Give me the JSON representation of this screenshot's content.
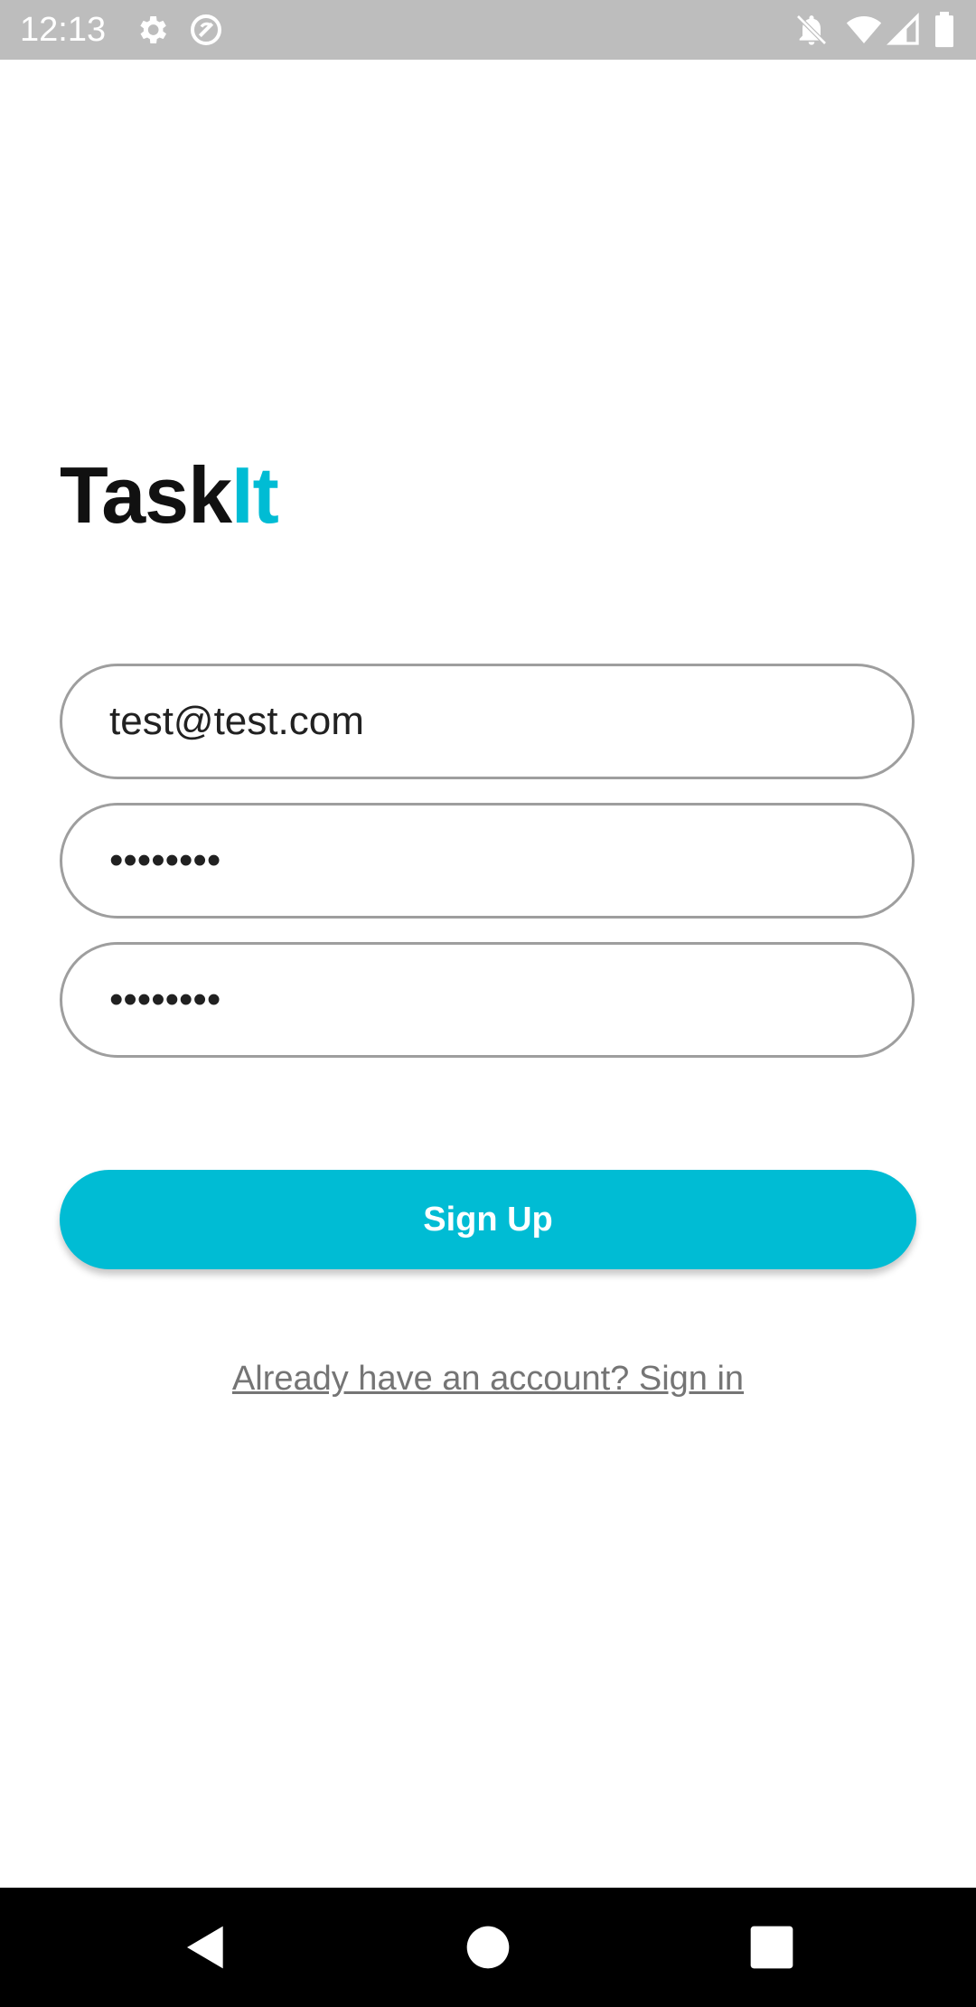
{
  "status_bar": {
    "time": "12:13",
    "left_icons": [
      "settings-icon",
      "sync-off-icon"
    ],
    "right_icons": [
      "notifications-off-icon",
      "wifi-icon",
      "signal-icon",
      "battery-icon"
    ]
  },
  "brand": {
    "part1": "Task",
    "part2": "It"
  },
  "form": {
    "email_value": "test@test.com",
    "password_value": "••••••••",
    "confirm_password_value": "••••••••"
  },
  "signup_button_label": "Sign Up",
  "signin_link_label": "Already have an account? Sign in",
  "nav": {
    "back": "back-icon",
    "home": "home-icon",
    "recents": "recents-icon"
  },
  "colors": {
    "accent": "#00bcd4",
    "status_bar": "#bdbdbd",
    "nav_bar": "#000000",
    "field_border": "#9e9e9e",
    "link_text": "#757575"
  }
}
